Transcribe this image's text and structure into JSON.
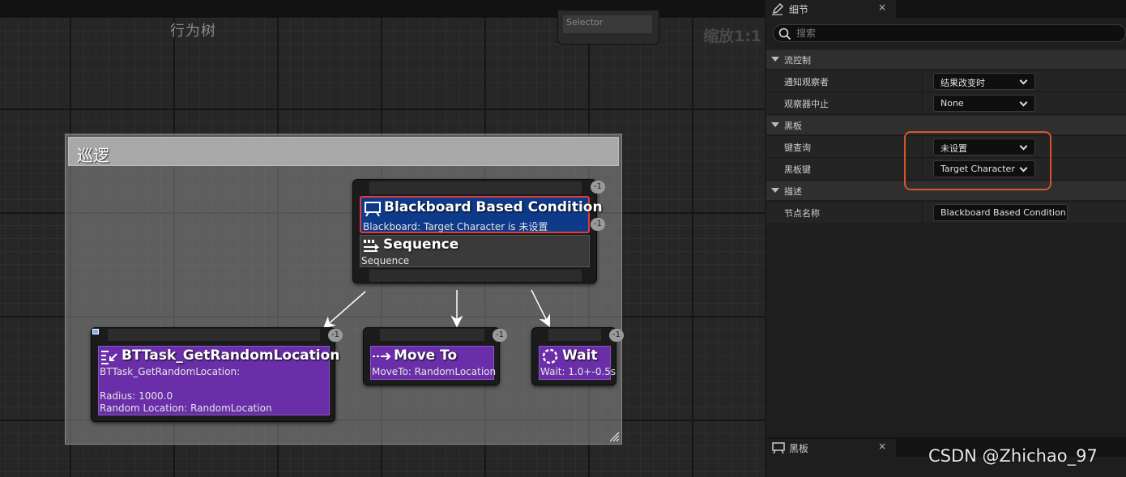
{
  "graph": {
    "title": "行为树",
    "zoom": "缩放1:1",
    "selector_stub": "Selector",
    "comment": "巡逻",
    "composite": {
      "decorator_title": "Blackboard Based Condition",
      "decorator_desc": "Blackboard: Target Character is 未设置",
      "sequence_title": "Sequence",
      "sequence_desc": "Sequence",
      "badge_top": "-1",
      "badge_dec": "-1"
    },
    "tasks": [
      {
        "title": "BTTask_GetRandomLocation",
        "line1": "BTTask_GetRandomLocation:",
        "line2": "",
        "line3": "Radius: 1000.0",
        "line4": "Random Location: RandomLocation",
        "badge": "-1"
      },
      {
        "title": "Move To",
        "line1": "MoveTo: RandomLocation",
        "badge": "-1"
      },
      {
        "title": "Wait",
        "line1": "Wait: 1.0+-0.5s",
        "badge": "-1"
      }
    ]
  },
  "details": {
    "tab_label": "细节",
    "close": "×",
    "search_placeholder": "搜索",
    "categories": {
      "flow": "流控制",
      "blackboard": "黑板",
      "description": "描述"
    },
    "props": {
      "notify_observer_label": "通知观察者",
      "notify_observer_value": "结果改变时",
      "observer_aborts_label": "观察器中止",
      "observer_aborts_value": "None",
      "key_query_label": "键查询",
      "key_query_value": "未设置",
      "bb_key_label": "黑板键",
      "bb_key_value": "Target Character",
      "node_name_label": "节点名称",
      "node_name_value": "Blackboard Based Condition"
    },
    "highlight_color": "#d9532c"
  },
  "blackboard_panel": {
    "tab_label": "黑板",
    "close": "×"
  },
  "watermark": "CSDN @Zhichao_97",
  "colors": {
    "decorator_bg": "#0e3a8a",
    "decorator_border": "#e23b3b",
    "task_bg": "#6a2fa8"
  }
}
